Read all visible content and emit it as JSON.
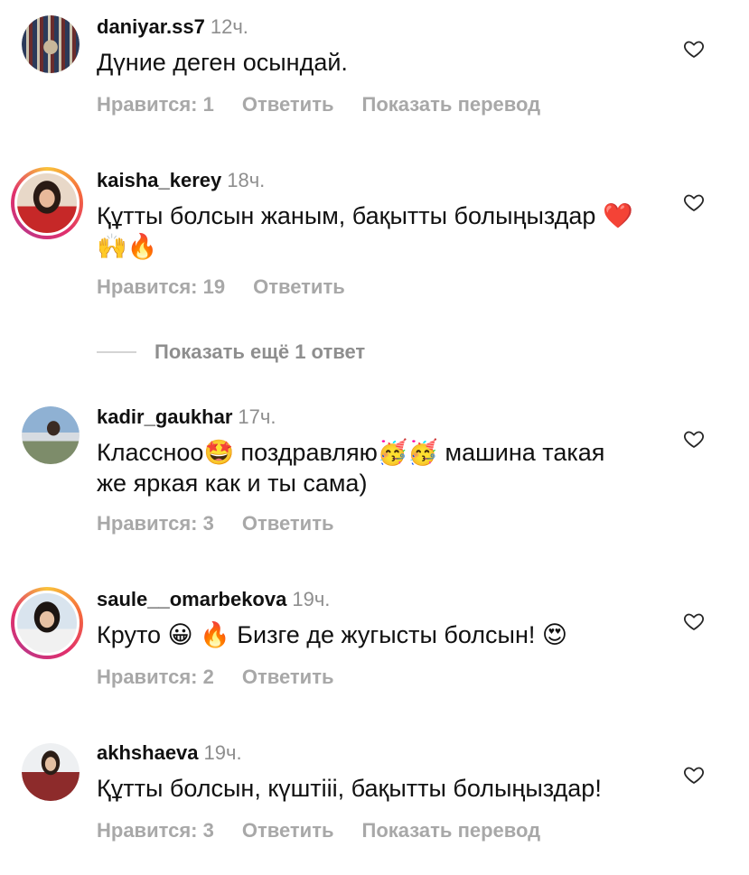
{
  "comments": [
    {
      "username": "daniyar.ss7",
      "time": "12ч.",
      "text": "Дүние деген осындай.",
      "likes": "Нравится: 1",
      "reply": "Ответить",
      "translate": "Показать перевод"
    },
    {
      "username": "kaisha_kerey",
      "time": "18ч.",
      "text": "Құтты болсын жаным, бақытты болыңыздар ❤️🙌🔥",
      "likes": "Нравится: 19",
      "reply": "Ответить"
    },
    {
      "username": "kadir_gaukhar",
      "time": "17ч.",
      "text": "Классноо🤩 поздравляю🥳🥳 машина такая же яркая как и ты сама)",
      "likes": "Нравится: 3",
      "reply": "Ответить"
    },
    {
      "username": "saule__omarbekova",
      "time": "19ч.",
      "text": "Круто 😀 🔥 Бизге де жугысты болсын! 😍",
      "likes": "Нравится: 2",
      "reply": "Ответить"
    },
    {
      "username": "akhshaeva",
      "time": "19ч.",
      "text": "Құтты болсын, күштііі, бақытты болыңыздар!",
      "likes": "Нравится: 3",
      "reply": "Ответить",
      "translate": "Показать перевод"
    }
  ],
  "more_replies": "Показать ещё 1 ответ",
  "icons": {
    "like": "heart-outline-icon"
  },
  "colors": {
    "secondary_text": "#8e8e8e",
    "action_text": "#a8a8a8",
    "story_ring": "#e1306c"
  }
}
